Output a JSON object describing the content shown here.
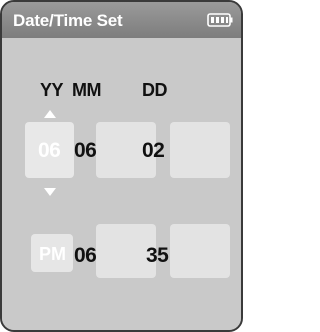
{
  "header": {
    "title": "Date/Time Set",
    "battery_icon": "battery-icon"
  },
  "date": {
    "labels": {
      "year": "YY",
      "month": "MM",
      "day": "DD"
    },
    "year": "06",
    "month": "06",
    "day": "02",
    "up_icon": "arrow-up-icon",
    "down_icon": "arrow-down-icon"
  },
  "time": {
    "ampm": "PM",
    "hour": "06",
    "minute": "35"
  },
  "colors": {
    "titlebar": "#8a8a8a",
    "panel": "#c9c9c9",
    "field": "#e3e3e3",
    "selected_text": "#ffffff"
  }
}
